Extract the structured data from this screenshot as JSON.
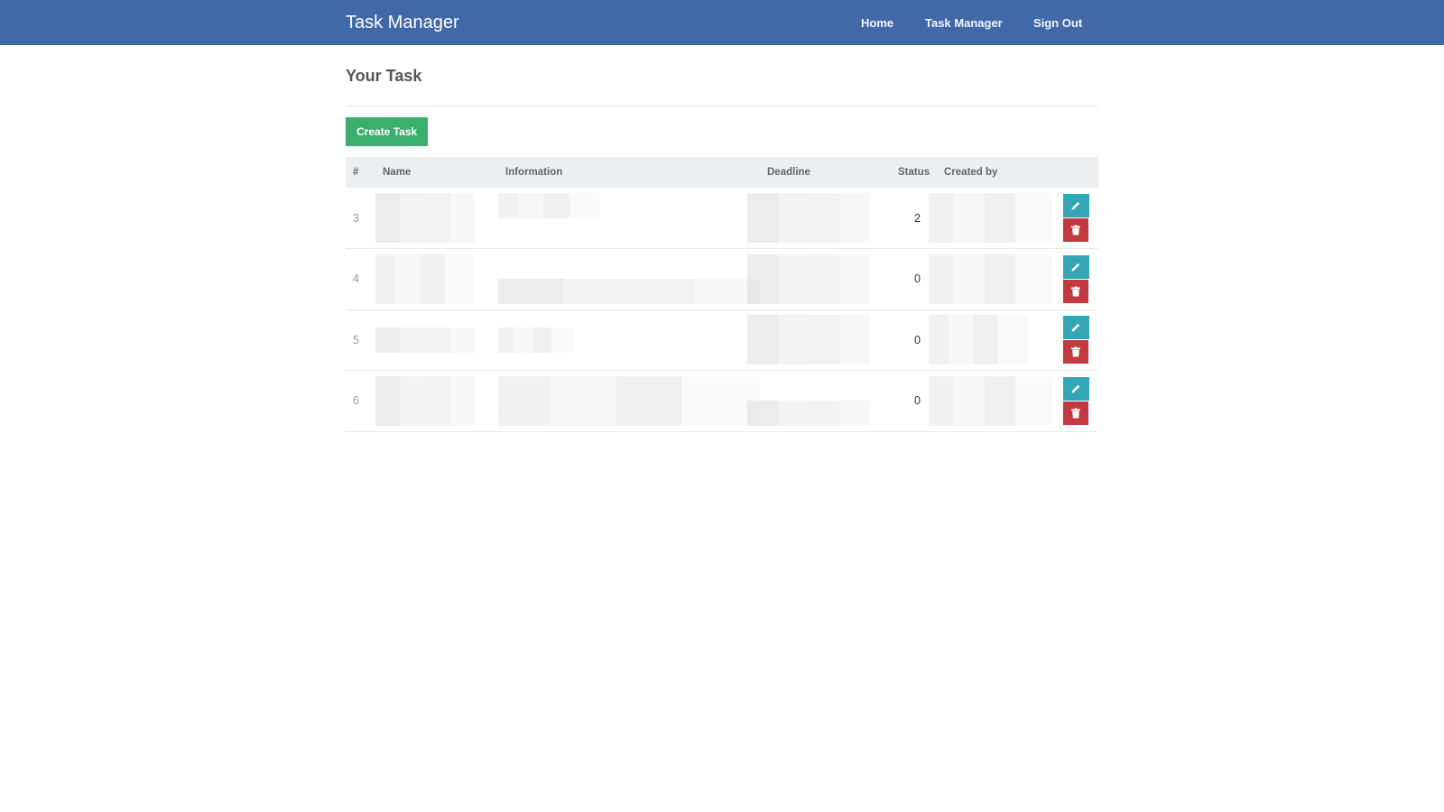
{
  "navbar": {
    "brand": "Task Manager",
    "links": [
      {
        "label": "Home"
      },
      {
        "label": "Task Manager"
      },
      {
        "label": "Sign Out"
      }
    ]
  },
  "page": {
    "title": "Your Task",
    "create_button": "Create Task"
  },
  "table": {
    "headers": [
      "#",
      "Name",
      "Information",
      "Deadline",
      "Status",
      "Created by"
    ],
    "rows": [
      {
        "num": "3",
        "status": "2"
      },
      {
        "num": "4",
        "status": "0"
      },
      {
        "num": "5",
        "status": "0"
      },
      {
        "num": "6",
        "status": "0"
      }
    ]
  },
  "icons": {
    "edit": "pencil-icon",
    "delete": "trash-icon"
  },
  "colors": {
    "navbar": "#4169a8",
    "create_button": "#3aaf6e",
    "edit_button": "#34a5b5",
    "delete_button": "#c2393f",
    "table_header": "#eceef0"
  }
}
